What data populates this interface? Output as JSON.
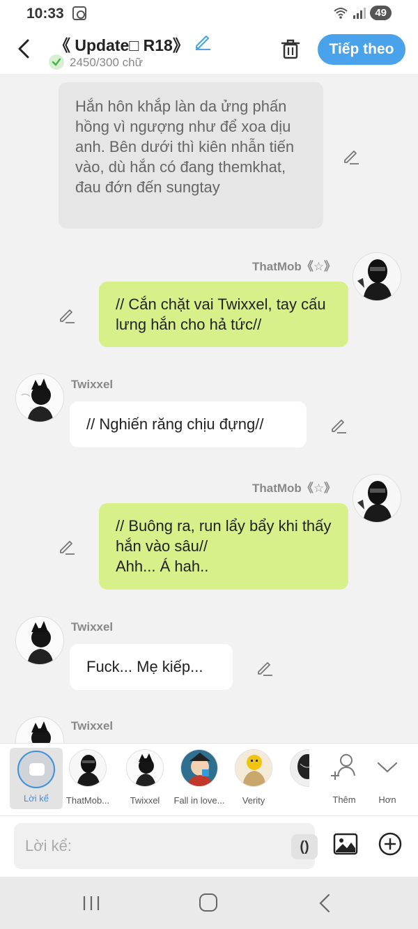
{
  "status": {
    "time": "10:33",
    "battery": "49"
  },
  "header": {
    "title": "《 Update□ R18》",
    "word_count": "2450/300 chữ",
    "next_label": "Tiếp theo"
  },
  "messages": [
    {
      "type": "narration",
      "text": "Hắn hôn khắp làn da ửng phấn hồng vì ngượng như để xoa dịu anh. Bên dưới thì kiên nhẫn tiến vào, dù hắn có đang themkhat, đau đớn đến sungtay"
    },
    {
      "type": "right",
      "name": "ThatMob《☆》",
      "text": "// Cắn chặt vai Twixxel, tay cấu lưng hắn cho hả tức//"
    },
    {
      "type": "left",
      "name": "Twixxel",
      "text": "// Nghiến răng chịu đựng//"
    },
    {
      "type": "right",
      "name": "ThatMob《☆》",
      "text": "// Buông ra, run lẩy bẩy khi thấy hắn vào sâu//\nAhh... Á hah.."
    },
    {
      "type": "left",
      "name": "Twixxel",
      "text": "Fuck... Mẹ kiếp..."
    },
    {
      "type": "left",
      "name": "Twixxel",
      "text": ""
    }
  ],
  "characters": {
    "narrator_label": "Lời kể",
    "items": [
      {
        "label": "ThatMob..."
      },
      {
        "label": "Twixxel"
      },
      {
        "label": "Fall in love..."
      },
      {
        "label": "Verity"
      },
      {
        "label": ""
      }
    ],
    "more_label": "Thêm",
    "expand_label": "Hơn"
  },
  "input": {
    "placeholder": "Lời kể:",
    "paren_label": "()"
  },
  "colors": {
    "accent": "#4aa3ea",
    "green_bubble": "#d8f08a",
    "narration_bubble": "#e6e6e6"
  }
}
